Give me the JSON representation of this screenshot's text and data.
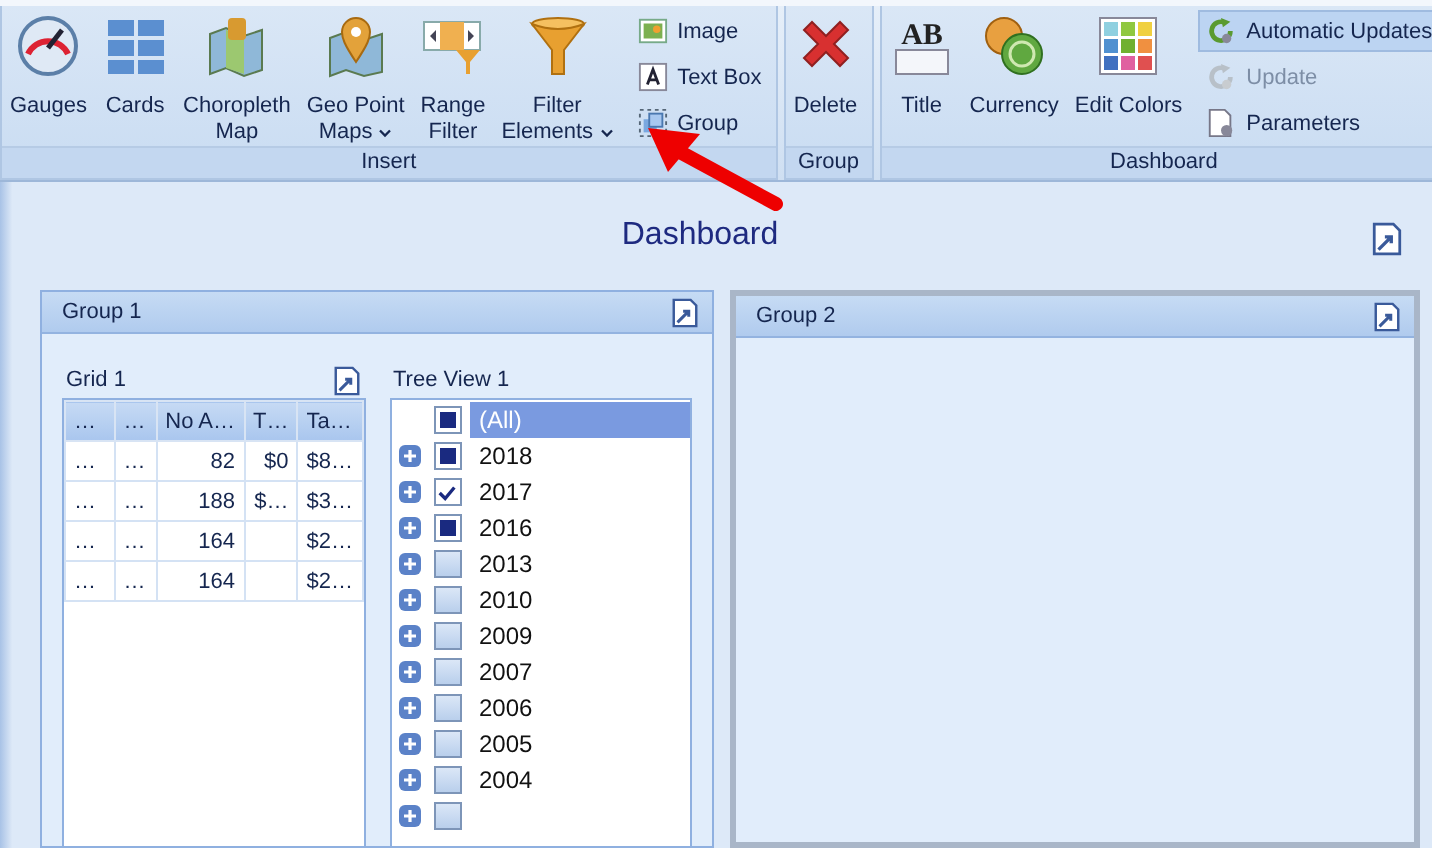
{
  "ribbon": {
    "groups": [
      {
        "label": "Insert",
        "items": [
          {
            "kind": "large",
            "label": "Gauges"
          },
          {
            "kind": "large",
            "label": "Cards"
          },
          {
            "kind": "large",
            "label": "Choropleth",
            "label2": "Map"
          },
          {
            "kind": "large",
            "label": "Geo Point",
            "label2": "Maps",
            "dropdown": true
          },
          {
            "kind": "large",
            "label": "Range",
            "label2": "Filter"
          },
          {
            "kind": "large",
            "label": "Filter",
            "label2": "Elements",
            "dropdown": true
          },
          {
            "kind": "smallcol",
            "items": [
              {
                "label": "Image",
                "selected": false,
                "disabled": false
              },
              {
                "label": "Text Box",
                "selected": false,
                "disabled": false
              },
              {
                "label": "Group",
                "selected": false,
                "disabled": false
              }
            ]
          }
        ]
      },
      {
        "label": "Group",
        "items": [
          {
            "kind": "large",
            "label": "Delete"
          }
        ]
      },
      {
        "label": "Dashboard",
        "items": [
          {
            "kind": "large",
            "icon_text": "AB",
            "label": "Title"
          },
          {
            "kind": "large",
            "label": "Currency"
          },
          {
            "kind": "large",
            "label": "Edit Colors"
          },
          {
            "kind": "smallcol",
            "items": [
              {
                "label": "Automatic Updates",
                "selected": true,
                "disabled": false
              },
              {
                "label": "Update",
                "selected": false,
                "disabled": true
              },
              {
                "label": "Parameters",
                "selected": false,
                "disabled": false
              }
            ]
          }
        ]
      }
    ]
  },
  "dashboard": {
    "title": "Dashboard",
    "groups": [
      {
        "title": "Group 1",
        "selected": false,
        "grid": {
          "title": "Grid 1",
          "columns": [
            "…",
            "…",
            "No A…",
            "T…",
            "Ta…"
          ],
          "rows": [
            [
              "…",
              "…",
              "82",
              "$0",
              "$8…"
            ],
            [
              "…",
              "…",
              "188",
              "$…",
              "$3…"
            ],
            [
              "…",
              "…",
              "164",
              null,
              "$2…"
            ],
            [
              "…",
              "…",
              "164",
              null,
              "$2…"
            ]
          ]
        },
        "tree": {
          "title": "Tree View 1",
          "items": [
            {
              "kind": "partial",
              "label": "(All)",
              "expandable": false,
              "selected": true
            },
            {
              "kind": "partial",
              "label": "2018",
              "expandable": true,
              "selected": false
            },
            {
              "kind": "checked",
              "label": "2017",
              "expandable": true,
              "selected": false
            },
            {
              "kind": "partial",
              "label": "2016",
              "expandable": true,
              "selected": false
            },
            {
              "kind": "unchecked",
              "label": "2013",
              "expandable": true,
              "selected": false
            },
            {
              "kind": "unchecked",
              "label": "2010",
              "expandable": true,
              "selected": false
            },
            {
              "kind": "unchecked",
              "label": "2009",
              "expandable": true,
              "selected": false
            },
            {
              "kind": "unchecked",
              "label": "2007",
              "expandable": true,
              "selected": false
            },
            {
              "kind": "unchecked",
              "label": "2006",
              "expandable": true,
              "selected": false
            },
            {
              "kind": "unchecked",
              "label": "2005",
              "expandable": true,
              "selected": false
            },
            {
              "kind": "unchecked",
              "label": "2004",
              "expandable": true,
              "selected": false
            },
            {
              "kind": "unchecked",
              "expandable": true,
              "selected": false
            }
          ]
        }
      },
      {
        "title": "Group 2",
        "selected": true
      }
    ]
  }
}
